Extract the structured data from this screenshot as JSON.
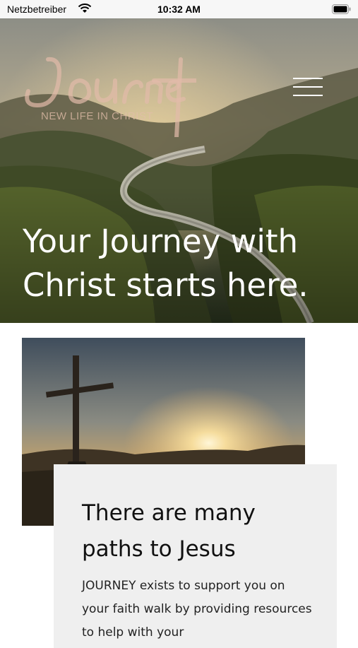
{
  "status_bar": {
    "carrier": "Netzbetreiber",
    "time": "10:32 AM",
    "icons": [
      "wifi-icon",
      "battery-icon"
    ]
  },
  "header": {
    "logo_script": "Journey",
    "logo_tagline": "NEW LIFE IN CHRIST",
    "menu_icon": "hamburger-menu-icon"
  },
  "hero": {
    "headline": "Your Journey with Christ starts here."
  },
  "feature": {
    "image": "cross-at-sunset",
    "heading": "There are many paths to Jesus",
    "body": "JOURNEY exists to support you on your faith walk by providing resources to help with your"
  },
  "colors": {
    "status_bar_bg": "#f7f7f7",
    "card_bg": "#efefef",
    "logo_tint": "#e0b8a8",
    "headline_text": "#ffffff"
  }
}
